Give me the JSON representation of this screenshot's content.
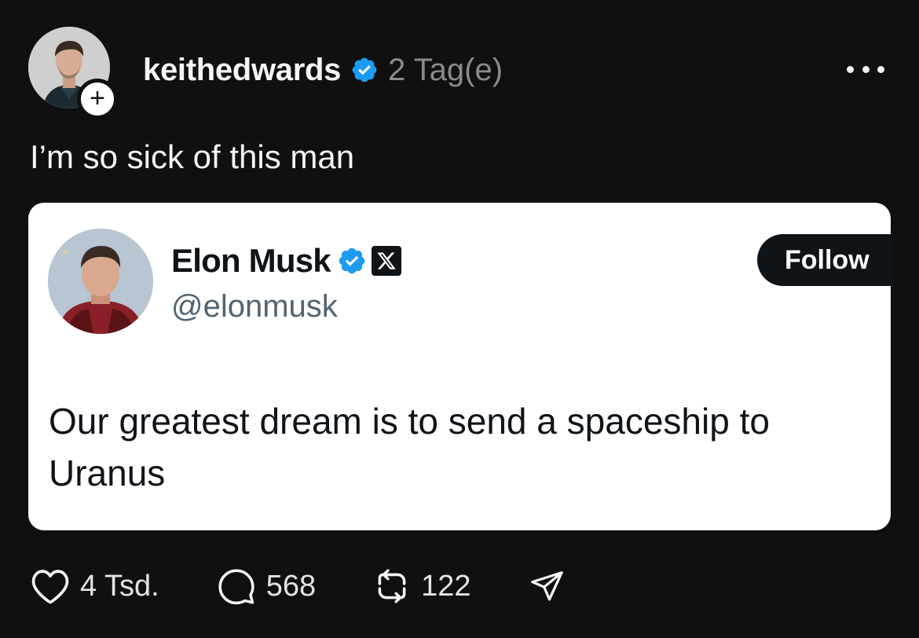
{
  "post": {
    "username": "keithedwards",
    "timestamp": "2 Tag(e)",
    "caption": "I’m so sick of this man"
  },
  "quoted_tweet": {
    "display_name": "Elon Musk",
    "handle": "@elonmusk",
    "follow_label": "Follow",
    "text": "Our greatest dream is to send a spaceship to Uranus"
  },
  "actions": {
    "likes": "4 Tsd.",
    "replies": "568",
    "reposts": "122"
  },
  "icons": {
    "verified": "verified-badge-icon",
    "more": "more-horizontal-icon",
    "like": "heart-icon",
    "reply": "speech-bubble-icon",
    "repost": "repost-arrows-icon",
    "share": "paper-plane-icon",
    "platform": "x-logo-icon"
  },
  "colors": {
    "background": "#101010",
    "verified_blue": "#1d9bf0",
    "card_background": "#ffffff",
    "muted_text": "#8a8a8a"
  }
}
